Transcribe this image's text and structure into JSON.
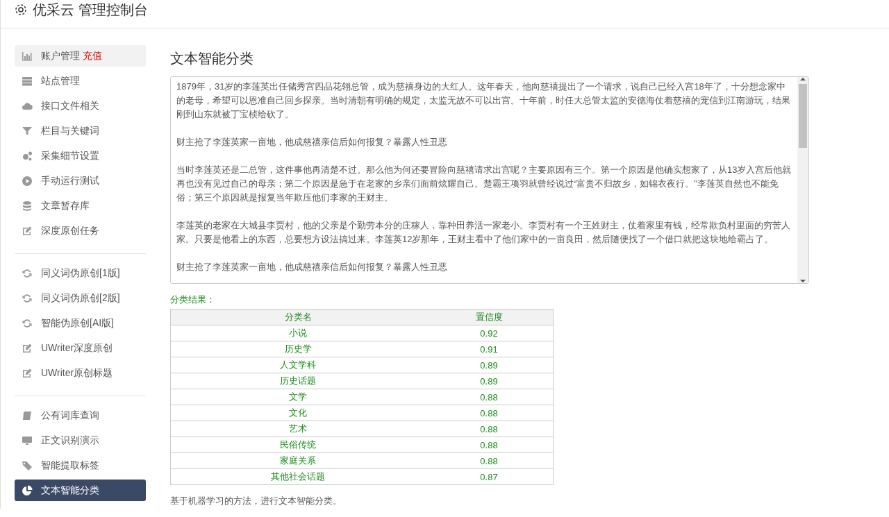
{
  "header": {
    "title": "优采云 管理控制台"
  },
  "sidebar": {
    "groups": [
      {
        "items": [
          {
            "label": "账户管理",
            "badge": "充值",
            "selected": false,
            "hovered": true
          },
          {
            "label": "站点管理",
            "selected": false,
            "hovered": false
          },
          {
            "label": "接口文件相关",
            "selected": false,
            "hovered": false
          },
          {
            "label": "栏目与关键词",
            "selected": false,
            "hovered": false
          },
          {
            "label": "采集细节设置",
            "selected": false,
            "hovered": false
          },
          {
            "label": "手动运行测试",
            "selected": false,
            "hovered": false
          },
          {
            "label": "文章暂存库",
            "selected": false,
            "hovered": false
          },
          {
            "label": "深度原创任务",
            "selected": false,
            "hovered": false
          }
        ]
      },
      {
        "items": [
          {
            "label": "同义词伪原创[1版]",
            "selected": false,
            "hovered": false
          },
          {
            "label": "同义词伪原创[2版]",
            "selected": false,
            "hovered": false
          },
          {
            "label": "智能伪原创[AI版]",
            "selected": false,
            "hovered": false
          },
          {
            "label": "UWriter深度原创",
            "selected": false,
            "hovered": false
          },
          {
            "label": "UWriter原创标题",
            "selected": false,
            "hovered": false
          }
        ]
      },
      {
        "items": [
          {
            "label": "公有词库查询",
            "selected": false,
            "hovered": false
          },
          {
            "label": "正文识别演示",
            "selected": false,
            "hovered": false
          },
          {
            "label": "智能提取标签",
            "selected": false,
            "hovered": false
          },
          {
            "label": "文本智能分类",
            "selected": true,
            "hovered": false
          }
        ]
      }
    ]
  },
  "main": {
    "title": "文本智能分类",
    "input_text": [
      "1879年，31岁的李莲英出任储秀宫四品花翎总管，成为慈禧身边的大红人。这年春天，他向慈禧提出了一个请求，说自己已经入宫18年了，十分想念家中的老母，希望可以恩准自己回乡探亲。当时清朝有明确的规定，太监无故不可以出宫。十年前，时任大总管太监的安德海仗着慈禧的宠信到江南游玩，结果刚到山东就被丁宝桢给砍了。",
      "财主抢了李莲英家一亩地，他成慈禧亲信后如何报复？暴露人性丑恶",
      "当时李莲英还是二总管，这件事他再清楚不过。那么他为何还要冒险向慈禧请求出宫呢？主要原因有三个。第一个原因是他确实想家了，从13岁入宫后他就再也没有见过自己的母亲；第二个原因是急于在老家的乡亲们面前炫耀自己。楚霸王项羽就曾经说过“富贵不归故乡，如锦衣夜行。”李莲英自然也不能免俗；第三个原因就是报复当年欺压他们李家的王财主。",
      "李莲英的老家在大城县李贾村，他的父亲是个勤劳本分的庄稼人，靠种田养活一家老小。李贾村有一个王姓财主，仗着家里有钱，经常欺负村里面的穷苦人家。只要是他看上的东西，总要想方设法搞过来。李莲英12岁那年，王财主看中了他们家中的一亩良田，然后随便找了一个借口就把这块地给霸占了。",
      "财主抢了李莲英家一亩地，他成慈禧亲信后如何报复？暴露人性丑恶"
    ],
    "result_label": "分类结果：",
    "table": {
      "columns": [
        "分类名",
        "置信度"
      ],
      "rows": [
        [
          "小说",
          "0.92"
        ],
        [
          "历史学",
          "0.91"
        ],
        [
          "人文学科",
          "0.89"
        ],
        [
          "历史话题",
          "0.89"
        ],
        [
          "文学",
          "0.88"
        ],
        [
          "文化",
          "0.88"
        ],
        [
          "艺术",
          "0.88"
        ],
        [
          "民俗传统",
          "0.88"
        ],
        [
          "家庭关系",
          "0.88"
        ],
        [
          "其他社会话题",
          "0.87"
        ]
      ]
    },
    "footnote": "基于机器学习的方法，进行文本智能分类。"
  }
}
